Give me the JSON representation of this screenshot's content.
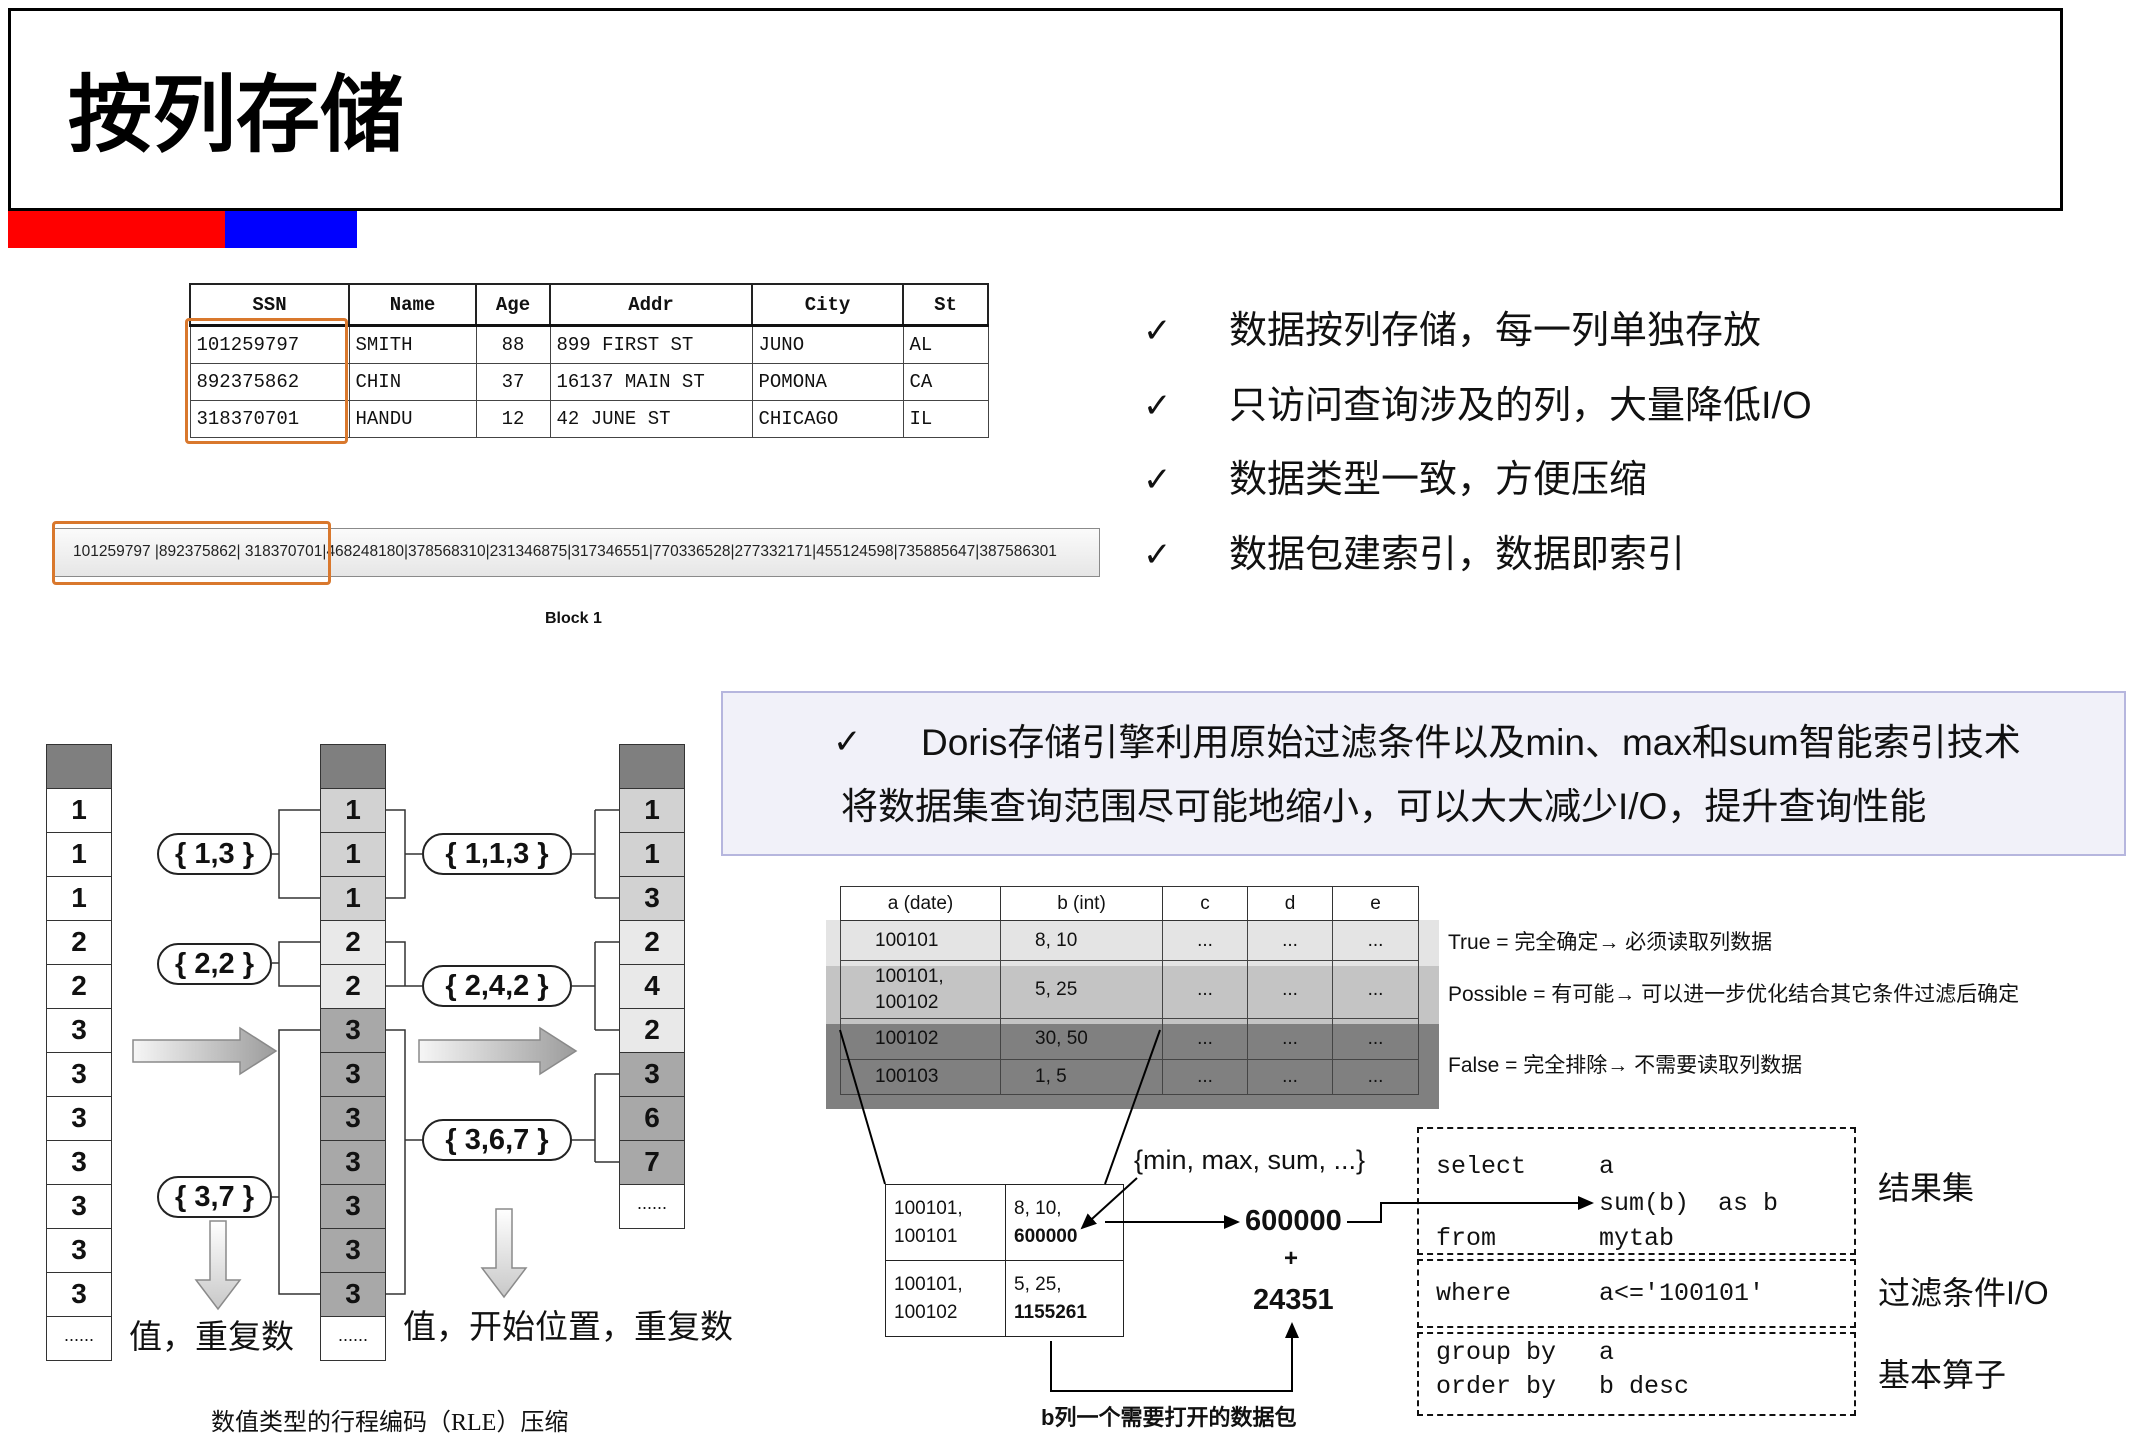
{
  "title": "按列存储",
  "colors": {
    "accent_red": "#ff0000",
    "accent_blue": "#0000ff",
    "highlight_orange": "#d9782d",
    "note_background": "#f1f1f9",
    "note_border": "#b6b6de",
    "band_true": "#e4e4e4",
    "band_possible": "#c4c4c4",
    "band_false": "#808080",
    "rle_header": "#7f7f7f",
    "rle_group_1": "#d2d2d2",
    "rle_group_2": "#e9e9e9",
    "rle_group_3": "#a8a8a8"
  },
  "row_table": {
    "headers": [
      "SSN",
      "Name",
      "Age",
      "Addr",
      "City",
      "St"
    ],
    "rows": [
      [
        "101259797",
        "SMITH",
        "88",
        "899 FIRST ST",
        "JUNO",
        "AL"
      ],
      [
        "892375862",
        "CHIN",
        "37",
        "16137 MAIN ST",
        "POMONA",
        "CA"
      ],
      [
        "318370701",
        "HANDU",
        "12",
        "42 JUNE ST",
        "CHICAGO",
        "IL"
      ]
    ]
  },
  "block": {
    "text": "101259797 |892375862| 318370701|468248180|378568310|231346875|317346551|770336528|277332171|455124598|735885647|387586301",
    "label": "Block 1"
  },
  "check_mark": "✓",
  "bullets": [
    "数据按列存储，每一列单独存放",
    "只访问查询涉及的列，大量降低I/O",
    "数据类型一致，方便压缩",
    "数据包建索引，数据即索引"
  ],
  "note": {
    "line1": "Doris存储引擎利用原始过滤条件以及min、max和sum智能索引技术",
    "line2": "将数据集查询范围尽可能地缩小，可以大大减少I/O，提升查询性能"
  },
  "rle": {
    "original": [
      "1",
      "1",
      "1",
      "2",
      "2",
      "3",
      "3",
      "3",
      "3",
      "3",
      "3",
      "3",
      "......"
    ],
    "sorted": [
      "1",
      "1",
      "1",
      "2",
      "2",
      "3",
      "3",
      "3",
      "3",
      "3",
      "3",
      "3",
      "......"
    ],
    "encoded": [
      "1",
      "1",
      "3",
      "2",
      "4",
      "2",
      "3",
      "6",
      "7",
      "......"
    ],
    "pairs": [
      "{ 1,3 }",
      "{ 2,2 }",
      "{ 3,7 }"
    ],
    "triples": [
      "{ 1,1,3 }",
      "{ 2,4,2 }",
      "{ 3,6,7 }"
    ],
    "pair_caption": "值，重复数",
    "triple_caption": "值，开始位置，重复数",
    "caption": "数值类型的行程编码（RLE）压缩"
  },
  "zonemap": {
    "headers": [
      "a (date)",
      "b (int)",
      "c",
      "d",
      "e"
    ],
    "rows": [
      [
        "100101",
        "8, 10",
        "...",
        "...",
        "..."
      ],
      [
        "100101,\n100102",
        "5, 25",
        "...",
        "...",
        "..."
      ],
      [
        "100102",
        "30, 50",
        "...",
        "...",
        "..."
      ],
      [
        "100103",
        "1, 5",
        "...",
        "...",
        "..."
      ]
    ],
    "legend": [
      "True = 完全确定→ 必须读取列数据",
      "Possible = 有可能→ 可以进一步优化结合其它条件过滤后确定",
      "False = 完全排除→ 不需要读取列数据"
    ]
  },
  "datapack": {
    "rows": [
      [
        {
          "top": "100101,",
          "bottom": "100101"
        },
        {
          "top": "8, 10,",
          "bottom": "600000"
        }
      ],
      [
        {
          "top": "100101,",
          "bottom": "100102"
        },
        {
          "top": "5, 25,",
          "bottom": "1155261"
        }
      ]
    ],
    "index_label": "{min, max, sum, ...}",
    "sum_first": "600000",
    "plus": "+",
    "sum_second": "24351",
    "caption": "b列一个需要打开的数据包"
  },
  "sql": {
    "select_kw": "select",
    "select_col": "a",
    "agg": "sum(b)",
    "alias": "as b",
    "from_kw": "from",
    "table": "mytab",
    "where_kw": "where",
    "where_cond": "a<='100101'",
    "group_kw": "group by",
    "group_col": "a",
    "order_kw": "order by",
    "order_col": "b desc"
  },
  "sql_labels": [
    "结果集",
    "过滤条件I/O",
    "基本算子"
  ]
}
